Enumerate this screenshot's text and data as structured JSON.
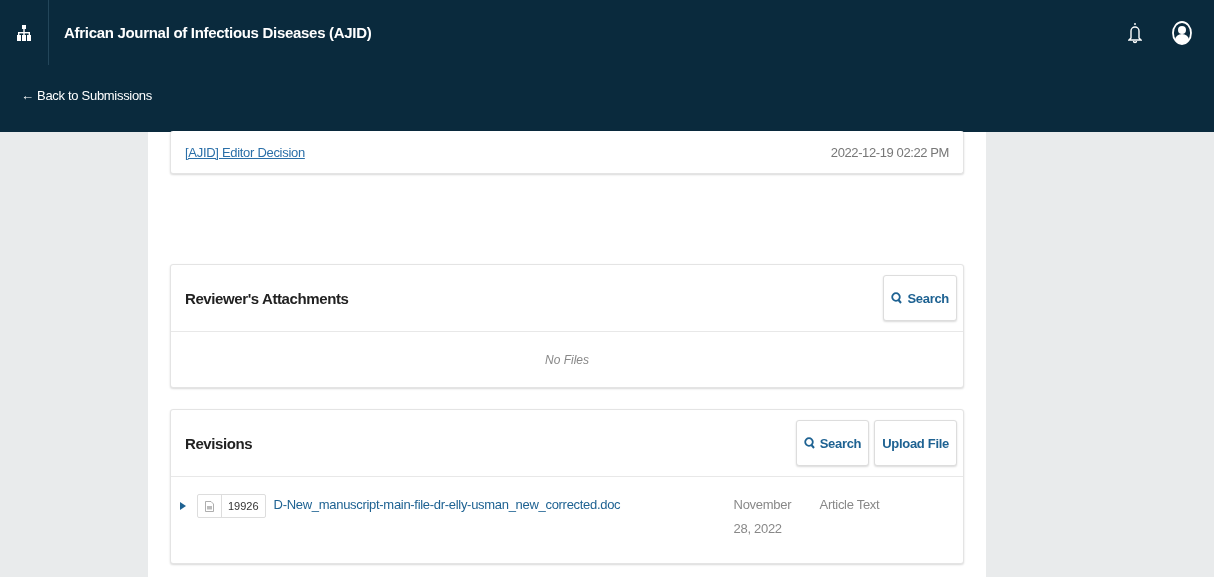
{
  "header": {
    "journal_title": "African Journal of Infectious Diseases (AJID)",
    "back_link": "← Back to Submissions"
  },
  "notification": {
    "link": "[AJID] Editor Decision",
    "date": "2022-12-19 02:22 PM"
  },
  "reviewer_attachments": {
    "title": "Reviewer's Attachments",
    "search_button": "Search",
    "empty_text": "No Files"
  },
  "revisions": {
    "title": "Revisions",
    "buttons": [
      "Search",
      "Upload File"
    ],
    "rows": [
      {
        "expanded": false,
        "file_id": "19926",
        "file_name": "D-New_manuscript-main-file-dr-elly-usman_new_corrected.doc",
        "date": "November 28, 2022",
        "type": "Article Text"
      }
    ]
  }
}
